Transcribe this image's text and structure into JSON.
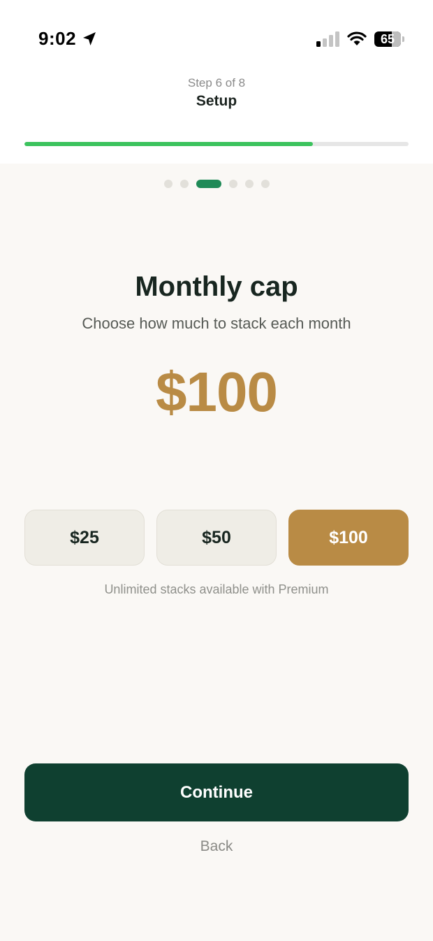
{
  "status_bar": {
    "time": "9:02",
    "battery_level": "65",
    "battery_percent": 65
  },
  "header": {
    "step_label": "Step 6 of 8",
    "title": "Setup",
    "progress": 0.75
  },
  "pager": {
    "dot_count": 6,
    "active_index": 2
  },
  "main": {
    "title": "Monthly cap",
    "subtitle": "Choose how much to stack each month",
    "amount": "$100",
    "options": [
      {
        "label": "$25",
        "selected": false
      },
      {
        "label": "$50",
        "selected": false
      },
      {
        "label": "$100",
        "selected": true
      }
    ],
    "premium_note": "Unlimited stacks available with Premium"
  },
  "actions": {
    "continue_label": "Continue",
    "back_label": "Back"
  },
  "colors": {
    "accent_gold": "#b98b45",
    "primary_green": "#0f4030",
    "progress_green": "#3cc35e",
    "dot_active": "#1f8a57"
  },
  "icons": {
    "location": "location-arrow-icon",
    "signal": "cellular-signal-icon",
    "wifi": "wifi-icon",
    "battery": "battery-icon"
  }
}
